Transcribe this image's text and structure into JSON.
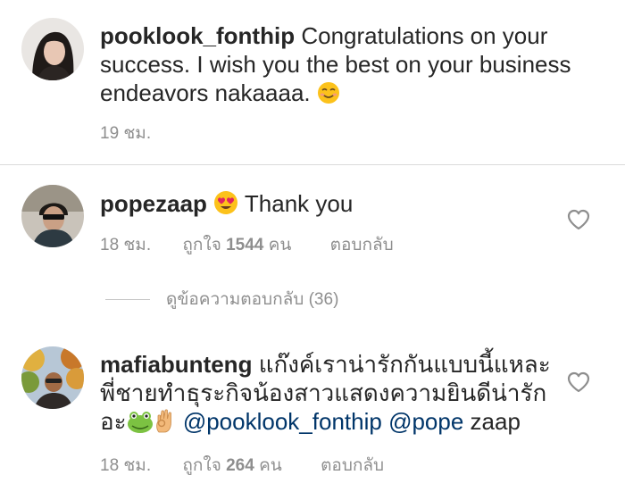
{
  "comments": [
    {
      "username": "pooklook_fonthip",
      "text": "Congratulations on your success. I wish you the best on your business endeavors nakaaaa.",
      "emoji": "smiling-face-icon",
      "time": "19 ชม."
    },
    {
      "username": "popezaap",
      "emoji": "heart-eyes-icon",
      "text": "Thank you",
      "time": "18 ชม.",
      "likes_label": "ถูกใจ",
      "likes_count": "1544",
      "likes_unit": "คน",
      "reply_label": "ตอบกลับ"
    },
    {
      "username": "mafiabunteng",
      "text_line1": "แก๊งค์เราน่ารักกันแบบนี้แหละ",
      "text_line2": "พี่ชายทำธุระกิจน้องสาวแสดงความยินดีน่ารัก",
      "text_line3_prefix": "อะ",
      "emojis": [
        "frog-face-icon",
        "ok-hand-icon"
      ],
      "mention1": "@pooklook_fonthip",
      "mention2": "@pope",
      "text_suffix": "zaap",
      "time": "18 ชม.",
      "likes_label": "ถูกใจ",
      "likes_count": "264",
      "likes_unit": "คน",
      "reply_label": "ตอบกลับ"
    }
  ],
  "view_replies": {
    "label": "ดูข้อความตอบกลับ (36)"
  },
  "colors": {
    "text": "#262626",
    "meta": "#8e8e8e",
    "mention": "#003569",
    "divider": "#dbdbdb"
  }
}
